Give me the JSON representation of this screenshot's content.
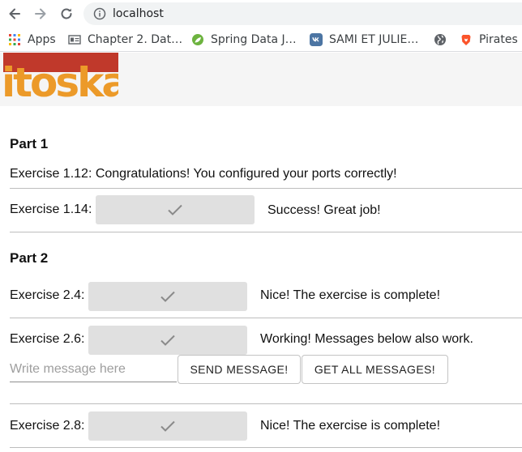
{
  "browser": {
    "url": "localhost",
    "bookmarks": [
      {
        "label": "Apps",
        "icon": "apps-grid-icon"
      },
      {
        "label": "Chapter 2. Dat…",
        "icon": "page-icon"
      },
      {
        "label": "Spring Data J…",
        "icon": "spring-leaf-icon"
      },
      {
        "label": "SAMI ET JULIE…",
        "icon": "vk-icon"
      },
      {
        "label": "",
        "icon": "globe-icon"
      },
      {
        "label": "Pirates a",
        "icon": "brave-icon"
      }
    ]
  },
  "logo": {
    "text": "itoska",
    "colors": {
      "orange": "#ec9a29",
      "red": "#c0392b"
    }
  },
  "part1": {
    "heading": "Part 1",
    "ex112": {
      "text": "Exercise 1.12: Congratulations! You configured your ports correctly!"
    },
    "ex114": {
      "label": "Exercise 1.14:",
      "message": "Success! Great job!"
    }
  },
  "part2": {
    "heading": "Part 2",
    "ex24": {
      "label": "Exercise 2.4:",
      "message": "Nice! The exercise is complete!"
    },
    "ex26": {
      "label": "Exercise 2.6:",
      "message": "Working! Messages below also work."
    },
    "message_form": {
      "placeholder": "Write message here",
      "send_label": "SEND MESSAGE!",
      "get_all_label": "GET ALL MESSAGES!"
    },
    "ex28": {
      "label": "Exercise 2.8:",
      "message": "Nice! The exercise is complete!"
    }
  },
  "colors": {
    "check_button_bg": "#e0e0e0",
    "check_mark": "#8a8a8a",
    "divider": "#bdbdbd",
    "header_band": "#f5f5f5"
  }
}
